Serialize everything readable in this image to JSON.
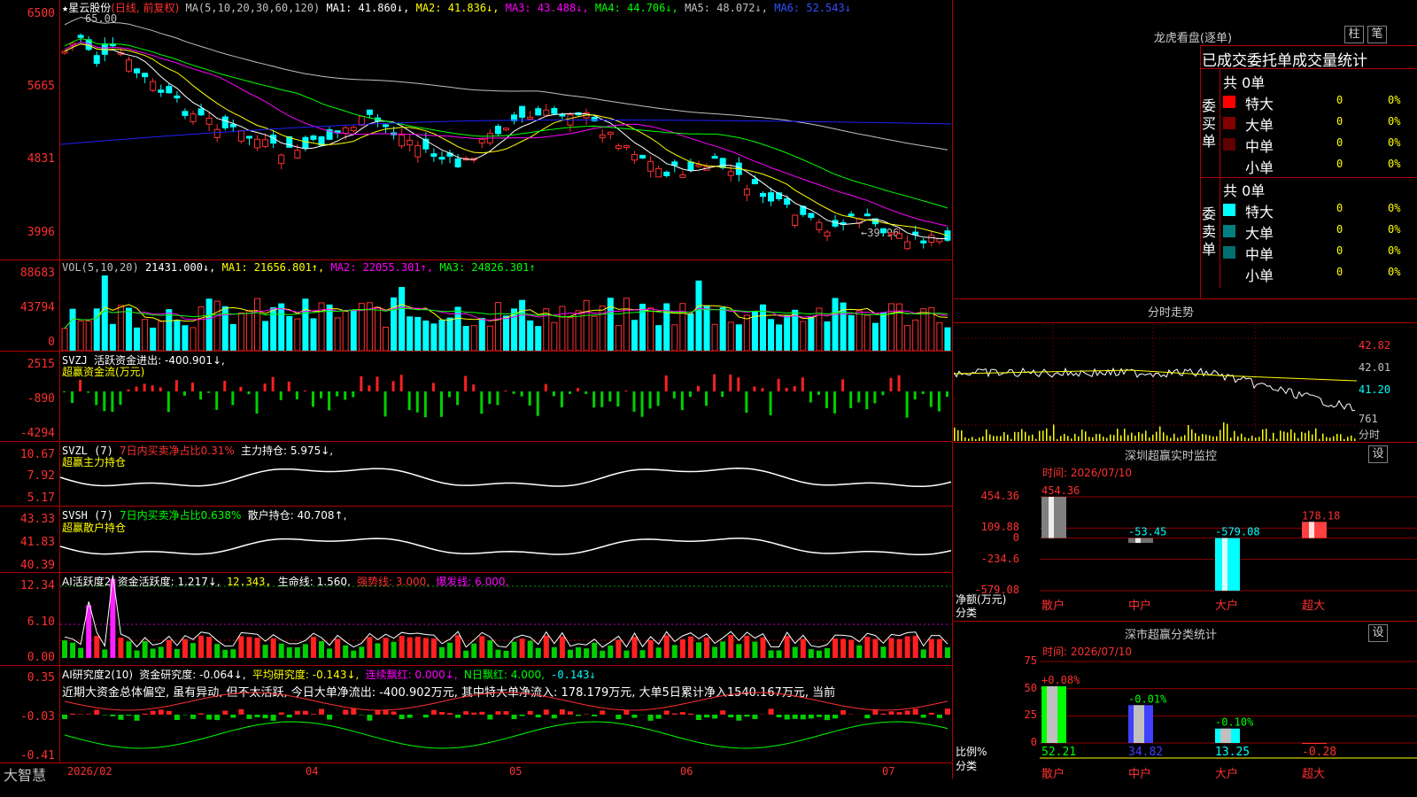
{
  "colors": {
    "up": "#ff3030",
    "down": "#00ffff",
    "ma1": "#ffffff",
    "ma2": "#ffff00",
    "ma3": "#ff00ff",
    "ma4": "#00ff00",
    "ma5": "#c0c0c0",
    "ma6": "#2020ff",
    "flow_up": "#ff2020",
    "flow_down": "#00d000",
    "panel_border": "#b00000"
  },
  "header": {
    "star": "★",
    "stock_name": "星云股份",
    "period": "(日线, 前复权)",
    "ma_label": "MA(5,10,20,30,60,120)",
    "ma1": "MA1: 41.860↓,",
    "ma2": "MA2: 41.836↓,",
    "ma3": "MA3: 43.488↓,",
    "ma4": "MA4: 44.706↓,",
    "ma5": "MA5: 48.072↓,",
    "ma6": "MA6: 52.543↓",
    "high_mark": "65.00",
    "low_mark": "←39.96"
  },
  "price_axis": [
    "6500",
    "5665",
    "4831",
    "3996"
  ],
  "vol": {
    "label": "VOL(5,10,20)",
    "value": "21431.000↓,",
    "ma1": "MA1: 21656.801↑,",
    "ma2": "MA2: 22055.301↑,",
    "ma3": "MA3: 24826.301↑",
    "axis": [
      "88683",
      "43794",
      "0"
    ]
  },
  "svzj": {
    "label": "SVZJ",
    "text": "活跃资金进出: -400.901↓,",
    "sub": "超赢资金流(万元)",
    "axis": [
      "2515",
      "-890",
      "-4294"
    ]
  },
  "svzl": {
    "label": "SVZL (7)",
    "text1": "7日内买卖净占比0.31%",
    "text2": "主力持仓: 5.975↓,",
    "sub": "超赢主力持仓",
    "axis": [
      "10.67",
      "7.92",
      "5.17"
    ]
  },
  "svsh": {
    "label": "SVSH (7)",
    "text1": "7日内买卖净占比0.638%",
    "text2": "散户持仓: 40.708↑,",
    "sub": "超赢散户持仓",
    "axis": [
      "43.33",
      "41.83",
      "40.39"
    ]
  },
  "ai1": {
    "label": "AI活跃度2",
    "t1": "资金活跃度: 1.217↓,",
    "t2": "12.343,",
    "t3": "生命线: 1.560,",
    "t4": "强势线: 3.000,",
    "t5": "爆发线: 6.000,",
    "axis": [
      "12.34",
      "6.10",
      "0.00"
    ]
  },
  "ai2": {
    "label": "AI研究度2(10)",
    "t1": "资金研究度: -0.064↓,",
    "t2": "平均研究度: -0.143↓,",
    "t3": "连续飘红: 0.000↓,",
    "t4": "N日飘红: 4.000,",
    "t5": "-0.143↓",
    "commentary": "近期大资金总体偏空, 虽有异动, 但不太活跃, 今日大单净流出: -400.902万元, 其中特大单净流入: 178.179万元, 大单5日累计净入1540.167万元, 当前",
    "axis": [
      "0.35",
      "-0.03",
      "-0.41"
    ]
  },
  "footer": {
    "brand": "大智慧",
    "dates": [
      "2026/02",
      "04",
      "05",
      "06",
      "07"
    ]
  },
  "dragon": {
    "title": "龙虎看盘(逐单)",
    "btn1": "柱",
    "btn2": "笔",
    "subtitle": "已成交委托单成交量统计",
    "buy_label": "委买单",
    "sell_label": "委卖单",
    "buy_total": "共 0单",
    "sell_total": "共 0单",
    "rows": [
      {
        "name": "特大",
        "v": "0",
        "p": "0%"
      },
      {
        "name": "大单",
        "v": "0",
        "p": "0%"
      },
      {
        "name": "中单",
        "v": "0",
        "p": "0%"
      },
      {
        "name": "小单",
        "v": "0",
        "p": "0%"
      }
    ]
  },
  "intraday": {
    "title": "分时走势",
    "axis": [
      "42.82",
      "42.01",
      "41.20",
      "761",
      "分时"
    ]
  },
  "sz_monitor": {
    "title": "深圳超赢实时监控",
    "btn": "设",
    "time": "时间: 2026/07/10",
    "axis": [
      "454.36",
      "109.88",
      "0",
      "-234.6",
      "-579.08"
    ],
    "ylabel": "净额(万元)",
    "xlabel": "分类",
    "bars": [
      {
        "cat": "散户",
        "value": 454.36,
        "label": "454.36"
      },
      {
        "cat": "中户",
        "value": -53.45,
        "label": "-53.45"
      },
      {
        "cat": "大户",
        "value": -579.08,
        "label": "-579.08"
      },
      {
        "cat": "超大",
        "value": 178.18,
        "label": "178.18"
      }
    ]
  },
  "sz_class": {
    "title": "深市超赢分类统计",
    "btn": "设",
    "time": "时间: 2026/07/10",
    "axis": [
      "75",
      "50",
      "25",
      "0"
    ],
    "ylabel": "比例%",
    "xlabel": "分类",
    "bars": [
      {
        "cat": "散户",
        "value": 52.21,
        "label": "52.21",
        "change": "+0.08%"
      },
      {
        "cat": "中户",
        "value": 34.82,
        "label": "34.82",
        "change": "-0.01%"
      },
      {
        "cat": "大户",
        "value": 13.25,
        "label": "13.25",
        "change": "-0.10%"
      },
      {
        "cat": "超大",
        "value": -0.28,
        "label": "-0.28",
        "change": ""
      }
    ]
  },
  "chart_data": [
    {
      "type": "line",
      "title": "星云股份 (日线, 前复权)",
      "note": "candlestick price chart",
      "ylim": [
        39.96,
        65.0
      ],
      "series": [
        {
          "name": "MA1",
          "values": [
            41.86
          ]
        },
        {
          "name": "MA2",
          "values": [
            41.836
          ]
        },
        {
          "name": "MA3",
          "values": [
            43.488
          ]
        },
        {
          "name": "MA4",
          "values": [
            44.706
          ]
        },
        {
          "name": "MA5",
          "values": [
            48.072
          ]
        },
        {
          "name": "MA6",
          "values": [
            52.543
          ]
        }
      ]
    },
    {
      "type": "bar",
      "title": "VOL(5,10,20)",
      "ylim": [
        0,
        88683
      ],
      "values": [
        21431.0
      ],
      "series": [
        {
          "name": "MA1",
          "values": [
            21656.801
          ]
        },
        {
          "name": "MA2",
          "values": [
            22055.301
          ]
        },
        {
          "name": "MA3",
          "values": [
            24826.301
          ]
        }
      ]
    },
    {
      "type": "bar",
      "title": "深圳超赢实时监控",
      "categories": [
        "散户",
        "中户",
        "大户",
        "超大"
      ],
      "values": [
        454.36,
        -53.45,
        -579.08,
        178.18
      ],
      "ylim": [
        -579.08,
        454.36
      ],
      "ylabel": "净额(万元)",
      "xlabel": "分类"
    },
    {
      "type": "bar",
      "title": "深市超赢分类统计",
      "categories": [
        "散户",
        "中户",
        "大户",
        "超大"
      ],
      "values": [
        52.21,
        34.82,
        13.25,
        -0.28
      ],
      "ylim": [
        0,
        75
      ],
      "ylabel": "比例%",
      "xlabel": "分类"
    }
  ]
}
